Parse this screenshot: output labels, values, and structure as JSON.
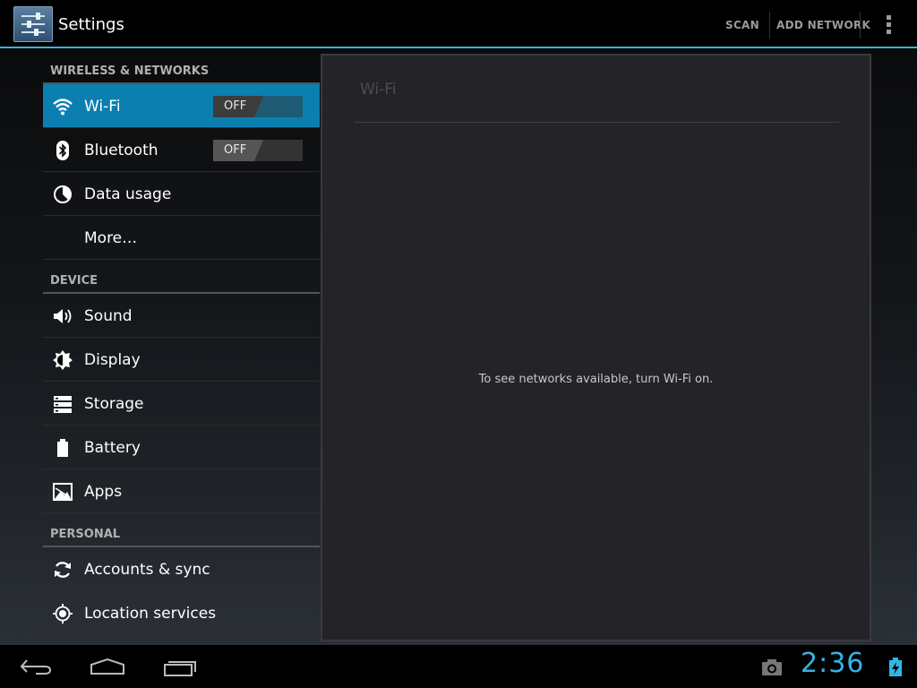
{
  "actionbar": {
    "title": "Settings",
    "actions": [
      "SCAN",
      "ADD NETWORK"
    ],
    "accent_color": "#33b5e5"
  },
  "sections": [
    {
      "header": "WIRELESS & NETWORKS",
      "items": [
        {
          "label": "Wi-Fi",
          "icon": "wifi-icon",
          "toggle": "OFF",
          "selected": true
        },
        {
          "label": "Bluetooth",
          "icon": "bluetooth-icon",
          "toggle": "OFF"
        },
        {
          "label": "Data usage",
          "icon": "data-usage-icon"
        },
        {
          "label": "More…",
          "icon": ""
        }
      ]
    },
    {
      "header": "DEVICE",
      "items": [
        {
          "label": "Sound",
          "icon": "sound-icon"
        },
        {
          "label": "Display",
          "icon": "display-icon"
        },
        {
          "label": "Storage",
          "icon": "storage-icon"
        },
        {
          "label": "Battery",
          "icon": "battery-icon"
        },
        {
          "label": "Apps",
          "icon": "apps-icon"
        }
      ]
    },
    {
      "header": "PERSONAL",
      "items": [
        {
          "label": "Accounts & sync",
          "icon": "sync-icon"
        },
        {
          "label": "Location services",
          "icon": "location-icon"
        }
      ]
    }
  ],
  "panel": {
    "title": "Wi-Fi",
    "message": "To see networks available, turn Wi-Fi on."
  },
  "statusbar": {
    "time": "2:36"
  }
}
